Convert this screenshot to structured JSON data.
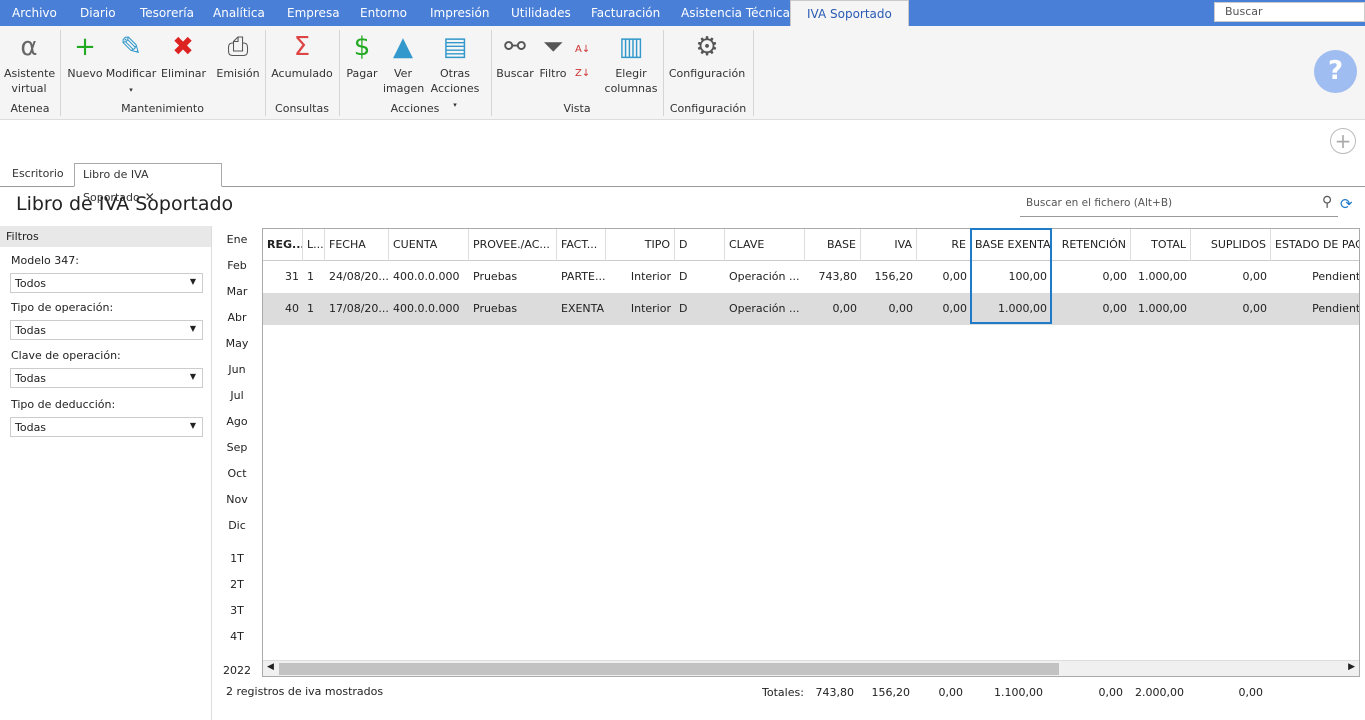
{
  "menu": {
    "tabs": [
      "Archivo",
      "Diario",
      "Tesorería",
      "Analítica",
      "Empresa",
      "Entorno",
      "Impresión",
      "Utilidades",
      "Facturación",
      "Asistencia Técnica",
      "IVA Soportado"
    ],
    "search": "Buscar"
  },
  "ribbon": {
    "buttons": [
      "Asistente virtual",
      "Nuevo",
      "Modificar",
      "Eliminar",
      "Emisión",
      "Acumulado",
      "Pagar",
      "Ver imagen",
      "Otras Acciones",
      "Buscar",
      "Filtro",
      "Elegir columnas",
      "Configuración"
    ],
    "groups": [
      "Atenea",
      "Mantenimiento",
      "Consultas",
      "Acciones",
      "Vista",
      "Configuración"
    ]
  },
  "doc_tabs": [
    "Escritorio",
    "Libro de IVA Soportado"
  ],
  "page_title": "Libro de IVA Soportado",
  "file_search_placeholder": "Buscar en el fichero (Alt+B)",
  "filters": {
    "title": "Filtros",
    "items": [
      {
        "label": "Modelo 347:",
        "value": "Todos"
      },
      {
        "label": "Tipo de operación:",
        "value": "Todas"
      },
      {
        "label": "Clave de operación:",
        "value": "Todas"
      },
      {
        "label": "Tipo de deducción:",
        "value": "Todas"
      }
    ]
  },
  "months": [
    "Ene",
    "Feb",
    "Mar",
    "Abr",
    "May",
    "Jun",
    "Jul",
    "Ago",
    "Sep",
    "Oct",
    "Nov",
    "Dic"
  ],
  "quarters": [
    "1T",
    "2T",
    "3T",
    "4T"
  ],
  "year": "2022",
  "table": {
    "columns": [
      "REG...",
      "L...",
      "FECHA",
      "CUENTA",
      "PROVEE./AC...",
      "FACT...",
      "TIPO",
      "D",
      "CLAVE",
      "BASE",
      "IVA",
      "RE",
      "BASE EXENTA",
      "RETENCIÓN",
      "TOTAL",
      "SUPLIDOS",
      "ESTADO DE PAGO"
    ],
    "rows": [
      [
        "31",
        "1",
        "24/08/20...",
        "400.0.0.000",
        "Pruebas",
        "PARTE...",
        "Interior",
        "D",
        "Operación ...",
        "743,80",
        "156,20",
        "0,00",
        "100,00",
        "0,00",
        "1.000,00",
        "0,00",
        "Pendiente"
      ],
      [
        "40",
        "1",
        "17/08/20...",
        "400.0.0.000",
        "Pruebas",
        "EXENTA",
        "Interior",
        "D",
        "Operación ...",
        "0,00",
        "0,00",
        "0,00",
        "1.000,00",
        "0,00",
        "1.000,00",
        "0,00",
        "Pendiente"
      ]
    ]
  },
  "footer": {
    "count": "2 registros de iva mostrados",
    "totals_label": "Totales:",
    "totals": [
      "743,80",
      "156,20",
      "0,00",
      "1.100,00",
      "0,00",
      "2.000,00",
      "0,00"
    ]
  }
}
